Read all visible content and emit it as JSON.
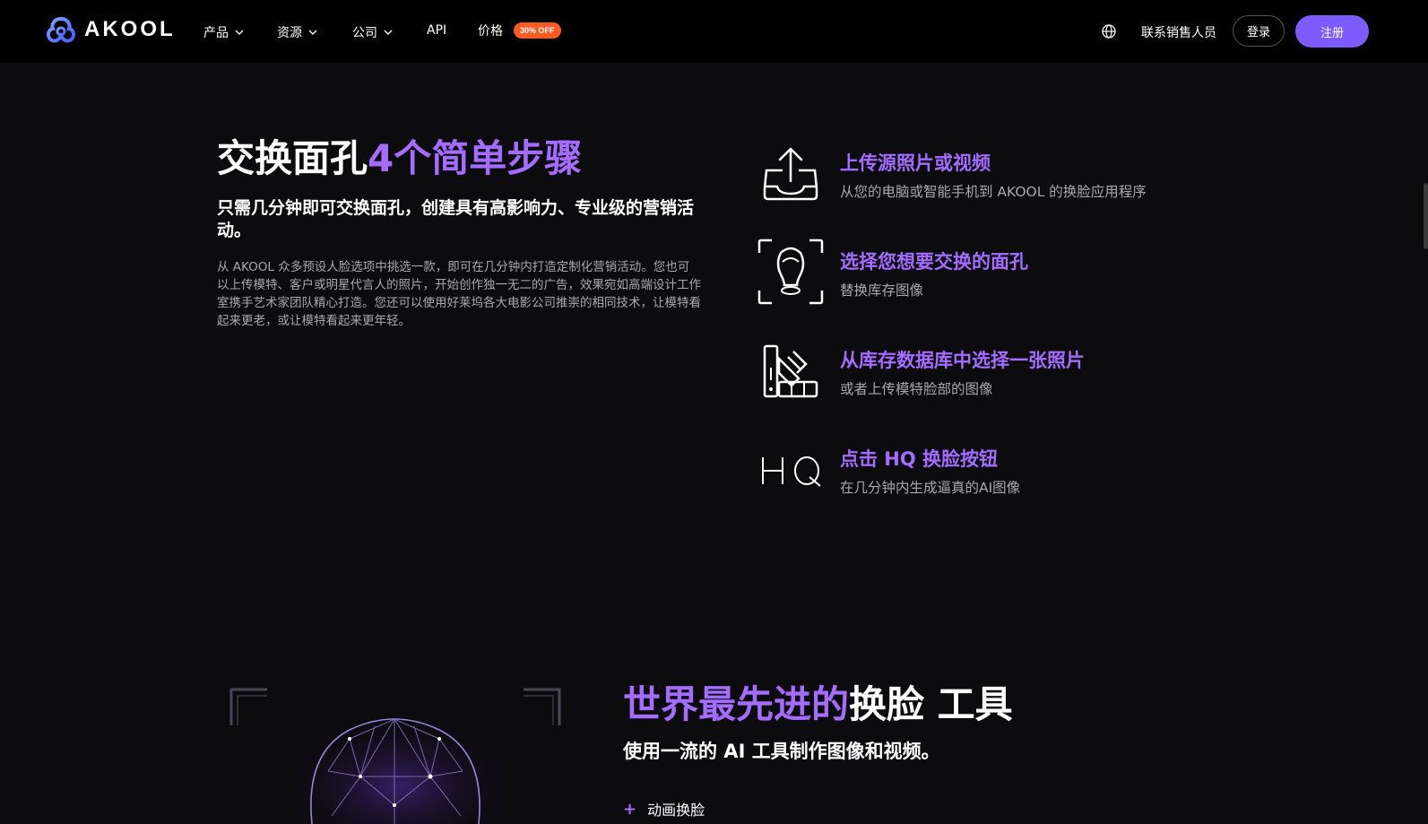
{
  "nav": {
    "brand": "AKOOL",
    "items": [
      {
        "label": "产品",
        "has_dropdown": true
      },
      {
        "label": "资源",
        "has_dropdown": true
      },
      {
        "label": "公司",
        "has_dropdown": true
      },
      {
        "label": "API",
        "has_dropdown": false
      },
      {
        "label": "价格",
        "has_dropdown": false
      }
    ],
    "price_badge": "30% OFF",
    "globe_icon": "globe-icon",
    "contact_sales": "联系销售人员",
    "login": "登录",
    "signup": "注册",
    "accent_color": "#7c5cff",
    "badge_color": "#ff5a1f"
  },
  "steps_section": {
    "title_white": "交换面孔",
    "title_purple": "4个简单步骤",
    "subtitle": "只需几分钟即可交换面孔，创建具有高影响力、专业级的营销活动。",
    "description": "从 AKOOL 众多预设人脸选项中挑选一款，即可在几分钟内打造定制化营销活动。您也可以上传模特、客户或明星代言人的照片，开始创作独一无二的广告，效果宛如高端设计工作室携手艺术家团队精心打造。您还可以使用好莱坞各大电影公司推崇的相同技术，让模特看起来更老，或让模特看起来更年轻。",
    "steps": [
      {
        "icon": "upload-icon",
        "title": "上传源照片或视频",
        "text": "从您的电脑或智能手机到 AKOOL 的换脸应用程序"
      },
      {
        "icon": "face-scan-icon",
        "title": "选择您想要交换的面孔",
        "text": "替换库存图像"
      },
      {
        "icon": "swatch-library-icon",
        "title": "从库存数据库中选择一张照片",
        "text": "或者上传模特脸部的图像"
      },
      {
        "icon": "hq-icon",
        "title": "点击 HQ 换脸按钮",
        "text": "在几分钟内生成逼真的AI图像"
      }
    ],
    "accent_color": "#a46cff"
  },
  "tools_section": {
    "title_purple": "世界最先进的",
    "title_white": "换脸 工具",
    "subtitle": "使用一流的 AI 工具制作图像和视频。",
    "list": [
      {
        "label": "动画换脸"
      }
    ]
  }
}
